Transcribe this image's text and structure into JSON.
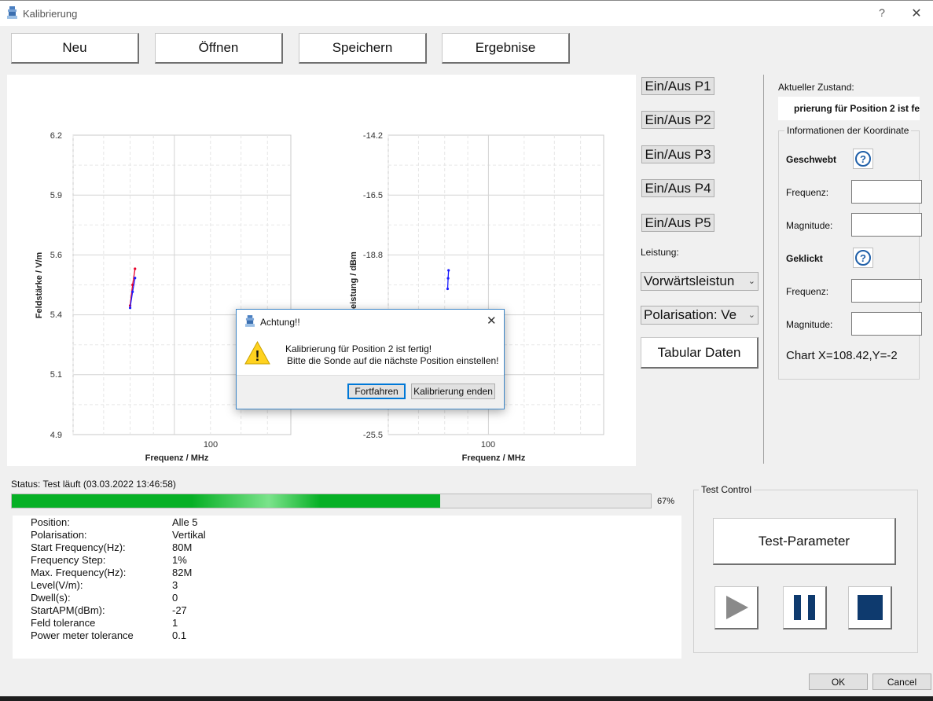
{
  "window": {
    "title": "Kalibrierung",
    "help_label": "?",
    "close_label": "✕"
  },
  "toolbar": {
    "neu_label": "Neu",
    "oeffnen_label": "Öffnen",
    "speichern_label": "Speichern",
    "ergebnise_label": "Ergebnise"
  },
  "chart_data": [
    {
      "type": "line",
      "xlabel": "Frequenz / MHz",
      "ylabel": "Feldstärke / V/m",
      "x_scale": "log",
      "x_ticks": [
        "100"
      ],
      "ylim": [
        4.9,
        6.2
      ],
      "y_ticks": [
        "6.2",
        "5.9",
        "5.6",
        "5.4",
        "5.1",
        "4.9"
      ],
      "grid": true,
      "series": [
        {
          "color": "#e8002a",
          "x": [
            80,
            81,
            82
          ],
          "y": [
            5.46,
            5.55,
            5.62
          ]
        },
        {
          "color": "#1a1aff",
          "x": [
            80,
            81,
            82
          ],
          "y": [
            5.45,
            5.52,
            5.58
          ]
        }
      ]
    },
    {
      "type": "line",
      "xlabel": "Frequenz / MHz",
      "ylabel": "tsleistung / dBm",
      "x_scale": "log",
      "x_ticks": [
        "100"
      ],
      "ylim": [
        -25.5,
        -14.2
      ],
      "y_ticks": [
        "-14.2",
        "-16.5",
        "-18.8",
        "-25.5"
      ],
      "grid": true,
      "series": [
        {
          "color": "#1a1aff",
          "x": [
            81.2,
            81.4,
            81.6
          ],
          "y": [
            -20.0,
            -19.6,
            -19.3
          ]
        }
      ]
    }
  ],
  "right_controls": {
    "p1": "Ein/Aus P1",
    "p2": "Ein/Aus P2",
    "p3": "Ein/Aus P3",
    "p4": "Ein/Aus P4",
    "p5": "Ein/Aus P5",
    "leistung_label": "Leistung:",
    "leistung_value": "Vorwärtsleistun",
    "polarisation_value": "Polarisation: Ve",
    "tabular_label": "Tabular Daten"
  },
  "state_panel": {
    "label": "Aktueller Zustand:",
    "value": "prierung für Position 2 ist fe",
    "group_title": "Informationen der Koordinate",
    "geschwebt": "Geschwebt",
    "geklickt": "Geklickt",
    "frequenz_label": "Frequenz:",
    "magnitude_label": "Magnitude:",
    "chart_readout": "Chart X=108.42,Y=-2",
    "help_glyph": "?"
  },
  "status": {
    "text": "Status: Test läuft (03.03.2022 13:46:58)",
    "progress": 67,
    "progress_label": "67%"
  },
  "parameters": [
    {
      "name": "Position:",
      "value": "Alle 5"
    },
    {
      "name": "Polarisation:",
      "value": "Vertikal"
    },
    {
      "name": "Start Frequency(Hz):",
      "value": "80M"
    },
    {
      "name": "Frequency Step:",
      "value": "1%"
    },
    {
      "name": "Max. Frequency(Hz):",
      "value": "82M"
    },
    {
      "name": "Level(V/m):",
      "value": "3"
    },
    {
      "name": "Dwell(s):",
      "value": "0"
    },
    {
      "name": "StartAPM(dBm):",
      "value": "-27"
    },
    {
      "name": "Feld tolerance",
      "value": "1"
    },
    {
      "name": "Power meter tolerance",
      "value": "0.1"
    }
  ],
  "test_control": {
    "title": "Test Control",
    "test_parameter_label": "Test-Parameter"
  },
  "footer": {
    "ok_label": "OK",
    "cancel_label": "Cancel"
  },
  "dialog": {
    "title": "Achtung!!",
    "close_label": "✕",
    "line1": "Kalibrierung für Position 2 ist fertig!",
    "line2": "Bitte die Sonde auf die nächste Position einstellen!",
    "fortfahren_label": "Fortfahren",
    "enden_label": "Kalibrierung enden",
    "warn_glyph": "!"
  }
}
